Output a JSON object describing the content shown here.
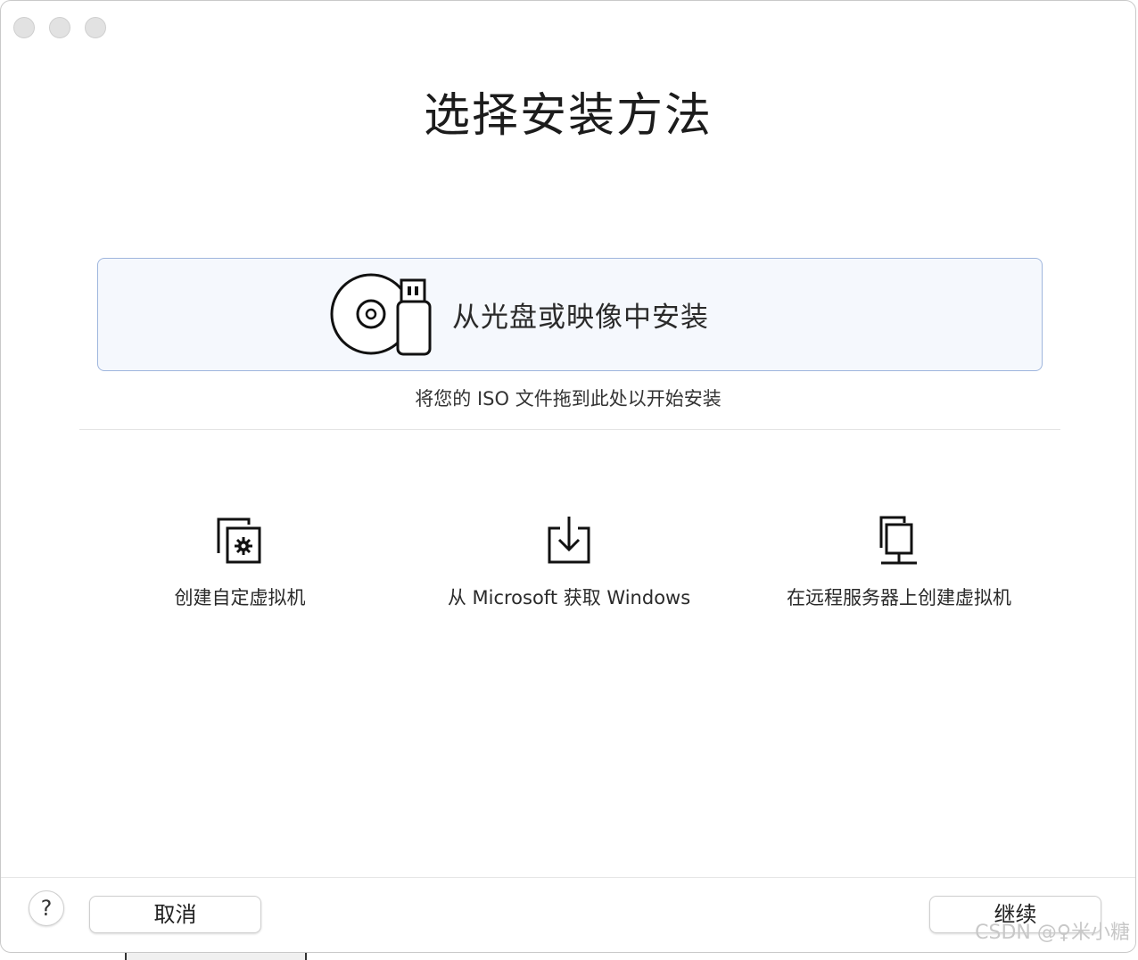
{
  "window": {
    "title": "选择安装方法"
  },
  "install_card": {
    "label": "从光盘或映像中安装",
    "icon": "disc-usb-icon"
  },
  "hint": "将您的 ISO 文件拖到此处以开始安装",
  "options": [
    {
      "label": "创建自定虚拟机",
      "icon": "custom-vm-icon"
    },
    {
      "label": "从 Microsoft 获取 Windows",
      "icon": "download-icon"
    },
    {
      "label": "在远程服务器上创建虚拟机",
      "icon": "remote-server-icon"
    }
  ],
  "footer": {
    "help": "?",
    "cancel": "取消",
    "continue": "继续"
  },
  "watermark": "CSDN @♀米小糖",
  "colors": {
    "card_background": "#f5f8fd",
    "card_border": "#9fb6dd"
  }
}
